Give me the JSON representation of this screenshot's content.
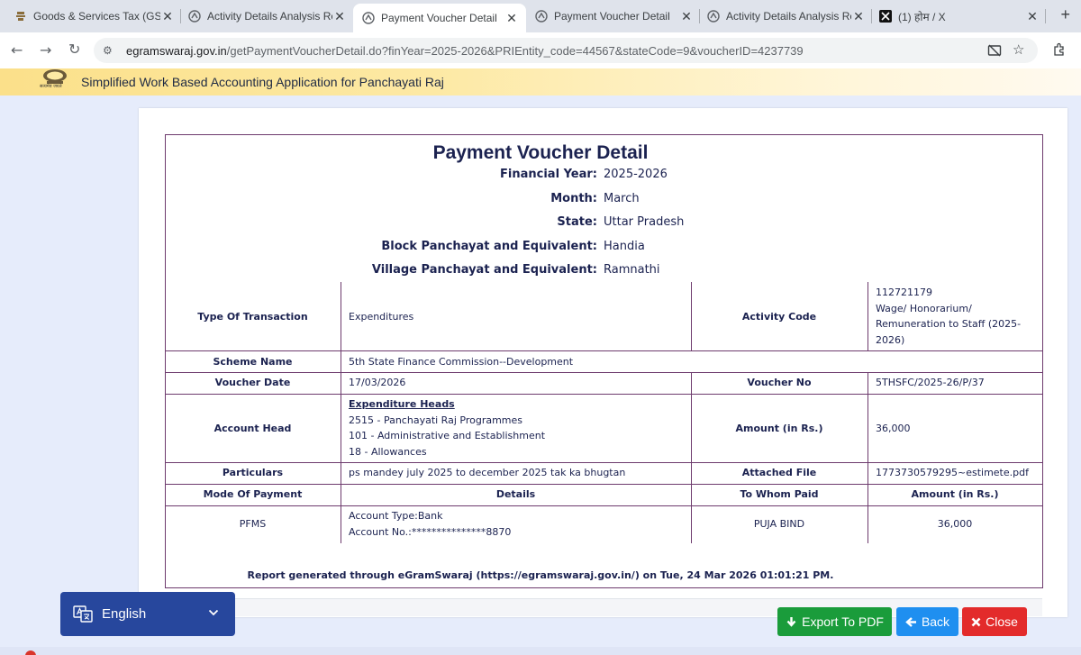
{
  "browser": {
    "tabs": [
      {
        "title": "Goods & Services Tax (GST)",
        "icon": "emblem-icon",
        "active": false
      },
      {
        "title": "Activity Details Analysis Rep",
        "icon": "globe-icon",
        "active": false
      },
      {
        "title": "Payment Voucher Detail",
        "icon": "globe-icon",
        "active": true
      },
      {
        "title": "Payment Voucher Detail",
        "icon": "globe-icon",
        "active": false
      },
      {
        "title": "Activity Details Analysis Rep",
        "icon": "globe-icon",
        "active": false
      },
      {
        "title": "(1) होम / X",
        "icon": "x-logo-icon",
        "active": false
      }
    ],
    "url_host": "egramswaraj.gov.in",
    "url_rest": "/getPaymentVoucherDetail.do?finYear=2025-2026&PRIEntity_code=44567&stateCode=9&voucherID=4237739"
  },
  "site": {
    "subtitle": "Simplified Work Based Accounting Application for Panchayati Raj",
    "emblem_caption": "सत्यमेव जयते"
  },
  "voucher": {
    "title": "Payment Voucher Detail",
    "meta": [
      {
        "label": "Financial Year:",
        "value": "2025-2026"
      },
      {
        "label": "Month:",
        "value": "March"
      },
      {
        "label": "State:",
        "value": "Uttar Pradesh"
      },
      {
        "label": "Block Panchayat and Equivalent:",
        "value": "Handia"
      },
      {
        "label": "Village Panchayat and Equivalent:",
        "value": "Ramnathi"
      }
    ],
    "type_of_transaction_label": "Type Of Transaction",
    "type_of_transaction": "Expenditures",
    "activity_code_label": "Activity Code",
    "activity_code_lines": [
      "112721179",
      "Wage/ Honorarium/",
      "Remuneration to Staff (2025-",
      "2026)"
    ],
    "scheme_name_label": "Scheme Name",
    "scheme_name": "5th State Finance Commission--Development",
    "voucher_date_label": "Voucher Date",
    "voucher_date": "17/03/2026",
    "voucher_no_label": "Voucher No",
    "voucher_no": "5THSFC/2025-26/P/37",
    "account_head_label": "Account Head",
    "expenditure_heads_title": "Expenditure Heads",
    "account_head_lines": [
      "2515 - Panchayati Raj Programmes",
      "101 - Administrative and Establishment",
      "18 - Allowances"
    ],
    "amount_label": "Amount (in Rs.)",
    "amount": "36,000",
    "particulars_label": "Particulars",
    "particulars": "ps mandey july 2025 to december 2025 tak ka bhugtan",
    "attached_file_label": "Attached File",
    "attached_file": "1773730579295~estimete.pdf",
    "payment_headers": [
      "Mode Of Payment",
      "Details",
      "To Whom Paid",
      "Amount (in Rs.)"
    ],
    "payment_row": {
      "mode": "PFMS",
      "details_lines": [
        "Account Type:Bank",
        "Account No.:***************8870"
      ],
      "to_whom": "PUJA BIND",
      "amount": "36,000"
    },
    "report_line": "Report generated through eGramSwaraj (https://egramswaraj.gov.in/) on Tue, 24 Mar 2026 01:01:21 PM."
  },
  "buttons": {
    "export_pdf": "Export To PDF",
    "back": "Back",
    "close": "Close"
  },
  "language": {
    "selected": "English"
  },
  "colors": {
    "pdf_button": "#1a9c3b",
    "back_button": "#1f8ff0",
    "close_button": "#e32b2b",
    "language_bar": "#27479d",
    "table_border": "#6d3a6d",
    "text": "#1b2250"
  }
}
